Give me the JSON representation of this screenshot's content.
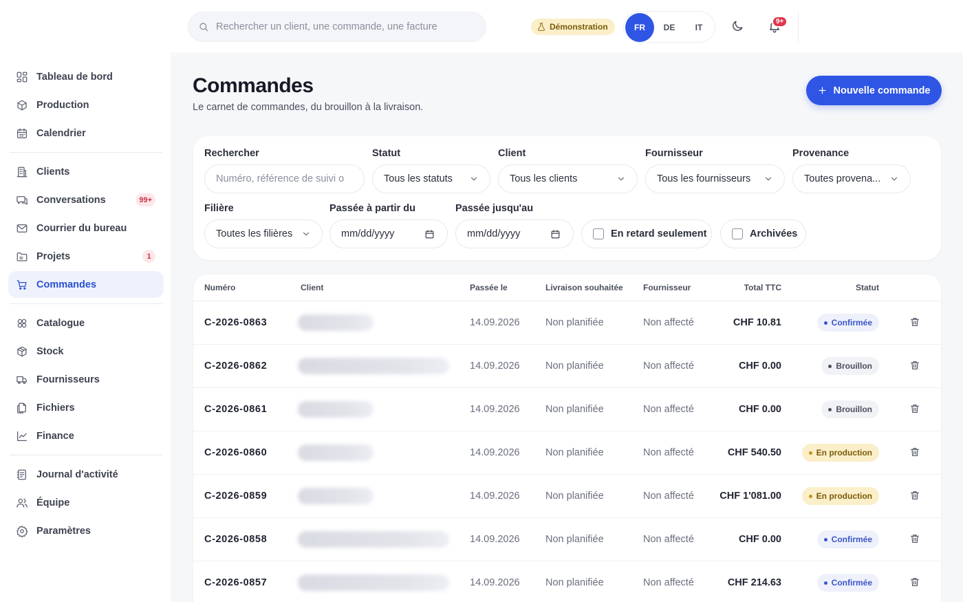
{
  "search": {
    "placeholder": "Rechercher un client, une commande, une facture"
  },
  "header": {
    "demo_label": "Démonstration",
    "languages": [
      "FR",
      "DE",
      "IT"
    ],
    "active_language": "FR",
    "notif_count": "9+"
  },
  "sidebar": {
    "items": [
      {
        "label": "Tableau de bord",
        "icon": "dashboard-icon"
      },
      {
        "label": "Production",
        "icon": "box-icon"
      },
      {
        "label": "Calendrier",
        "icon": "calendar-icon"
      },
      {
        "label": "Clients",
        "icon": "building-icon"
      },
      {
        "label": "Conversations",
        "icon": "chat-icon",
        "badge": "99+"
      },
      {
        "label": "Courrier du bureau",
        "icon": "mail-icon"
      },
      {
        "label": "Projets",
        "icon": "folder-icon",
        "badge": "1"
      },
      {
        "label": "Commandes",
        "icon": "cart-icon",
        "active": true
      },
      {
        "label": "Catalogue",
        "icon": "catalog-icon"
      },
      {
        "label": "Stock",
        "icon": "package-icon"
      },
      {
        "label": "Fournisseurs",
        "icon": "truck-icon"
      },
      {
        "label": "Fichiers",
        "icon": "files-icon"
      },
      {
        "label": "Finance",
        "icon": "chart-icon"
      },
      {
        "label": "Journal d'activité",
        "icon": "log-icon"
      },
      {
        "label": "Équipe",
        "icon": "team-icon"
      },
      {
        "label": "Paramètres",
        "icon": "gear-icon"
      }
    ]
  },
  "page": {
    "title": "Commandes",
    "subtitle": "Le carnet de commandes, du brouillon à la livraison.",
    "new_button": "Nouvelle commande"
  },
  "filters": {
    "search_label": "Rechercher",
    "search_placeholder": "Numéro, référence de suivi o",
    "statut_label": "Statut",
    "statut_value": "Tous les statuts",
    "client_label": "Client",
    "client_value": "Tous les clients",
    "fournisseur_label": "Fournisseur",
    "fournisseur_value": "Tous les fournisseurs",
    "provenance_label": "Provenance",
    "provenance_value": "Toutes provena...",
    "filiere_label": "Filière",
    "filiere_value": "Toutes les filières",
    "from_label": "Passée à partir du",
    "from_value": "mm/dd/yyyy",
    "to_label": "Passée jusqu'au",
    "to_value": "mm/dd/yyyy",
    "late_label": "En retard seulement",
    "archived_label": "Archivées"
  },
  "table": {
    "columns": [
      "Numéro",
      "Client",
      "Passée le",
      "Livraison souhaitée",
      "Fournisseur",
      "Total TTC",
      "Statut"
    ],
    "rows": [
      {
        "numero": "C-2026-0863",
        "date": "14.09.2026",
        "livraison": "Non planifiée",
        "fournisseur": "Non affecté",
        "total": "CHF 10.81",
        "statut": "Confirmée",
        "kind": "conf"
      },
      {
        "numero": "C-2026-0862",
        "date": "14.09.2026",
        "livraison": "Non planifiée",
        "fournisseur": "Non affecté",
        "total": "CHF 0.00",
        "statut": "Brouillon",
        "kind": "brou"
      },
      {
        "numero": "C-2026-0861",
        "date": "14.09.2026",
        "livraison": "Non planifiée",
        "fournisseur": "Non affecté",
        "total": "CHF 0.00",
        "statut": "Brouillon",
        "kind": "brou"
      },
      {
        "numero": "C-2026-0860",
        "date": "14.09.2026",
        "livraison": "Non planifiée",
        "fournisseur": "Non affecté",
        "total": "CHF 540.50",
        "statut": "En production",
        "kind": "prod"
      },
      {
        "numero": "C-2026-0859",
        "date": "14.09.2026",
        "livraison": "Non planifiée",
        "fournisseur": "Non affecté",
        "total": "CHF 1'081.00",
        "statut": "En production",
        "kind": "prod"
      },
      {
        "numero": "C-2026-0858",
        "date": "14.09.2026",
        "livraison": "Non planifiée",
        "fournisseur": "Non affecté",
        "total": "CHF 0.00",
        "statut": "Confirmée",
        "kind": "conf"
      },
      {
        "numero": "C-2026-0857",
        "date": "14.09.2026",
        "livraison": "Non planifiée",
        "fournisseur": "Non affecté",
        "total": "CHF 214.63",
        "statut": "Confirmée",
        "kind": "conf"
      }
    ]
  },
  "colors": {
    "accent": "#2f55e4",
    "active_nav_bg": "#eef2fc",
    "badge_red": "#e0364e",
    "status_confirmed": "#3a55c8",
    "status_production": "#c99312"
  }
}
